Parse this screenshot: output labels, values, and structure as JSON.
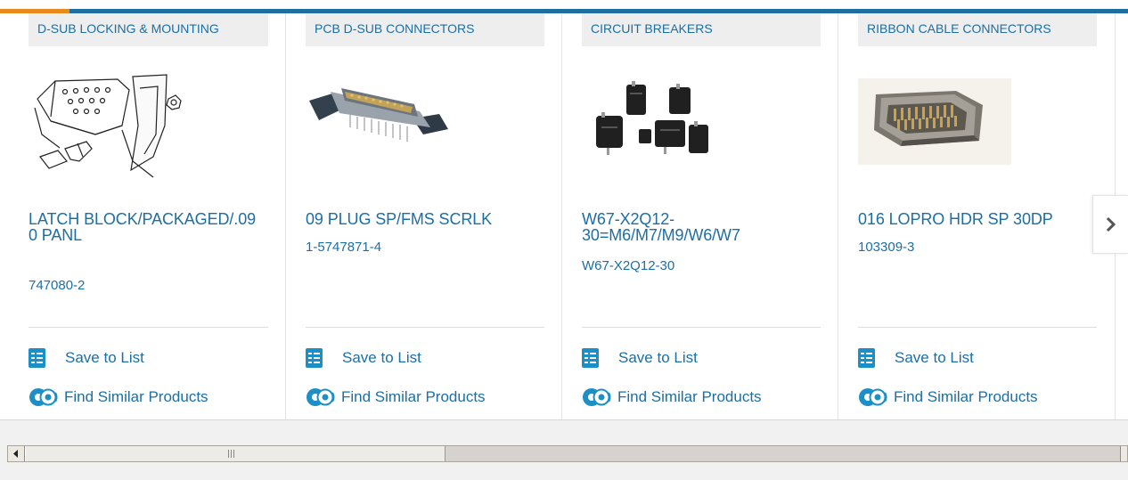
{
  "colors": {
    "link": "#1d6ea3",
    "accent_bar": "#1d6ea3",
    "accent_orange": "#e8891b",
    "category_bg": "#eeeeee",
    "icon_blue": "#1d8fc7"
  },
  "cards": [
    {
      "category": "D-SUB LOCKING & MOUNTING",
      "title": "LATCH BLOCK/PACKAGED/.09 0 PANL",
      "part_number": "747080-2",
      "image": "latch-block-drawing",
      "save_label": "Save to List",
      "similar_label": "Find Similar Products"
    },
    {
      "category": "PCB D-SUB CONNECTORS",
      "title": "09 PLUG SP/FMS SCRLK",
      "part_number": "1-5747871-4",
      "image": "d-sub-plug-photo",
      "save_label": "Save to List",
      "similar_label": "Find Similar Products"
    },
    {
      "category": "CIRCUIT BREAKERS",
      "title": "W67-X2Q12-30=M6/M7/M9/W6/W7",
      "part_number": "W67-X2Q12-30",
      "image": "circuit-breakers-photo",
      "save_label": "Save to List",
      "similar_label": "Find Similar Products"
    },
    {
      "category": "RIBBON CABLE CONNECTORS",
      "title": "016 LOPRO HDR SP 30DP",
      "part_number": "103309-3",
      "image": "ribbon-header-photo",
      "save_label": "Save to List",
      "similar_label": "Find Similar Products"
    }
  ],
  "carousel": {
    "next_icon": "chevron-right-icon"
  },
  "scrollbar": {
    "left_arrow_icon": "scroll-left-arrow-icon",
    "position_fraction": 0.0,
    "visible_fraction": 0.38
  }
}
